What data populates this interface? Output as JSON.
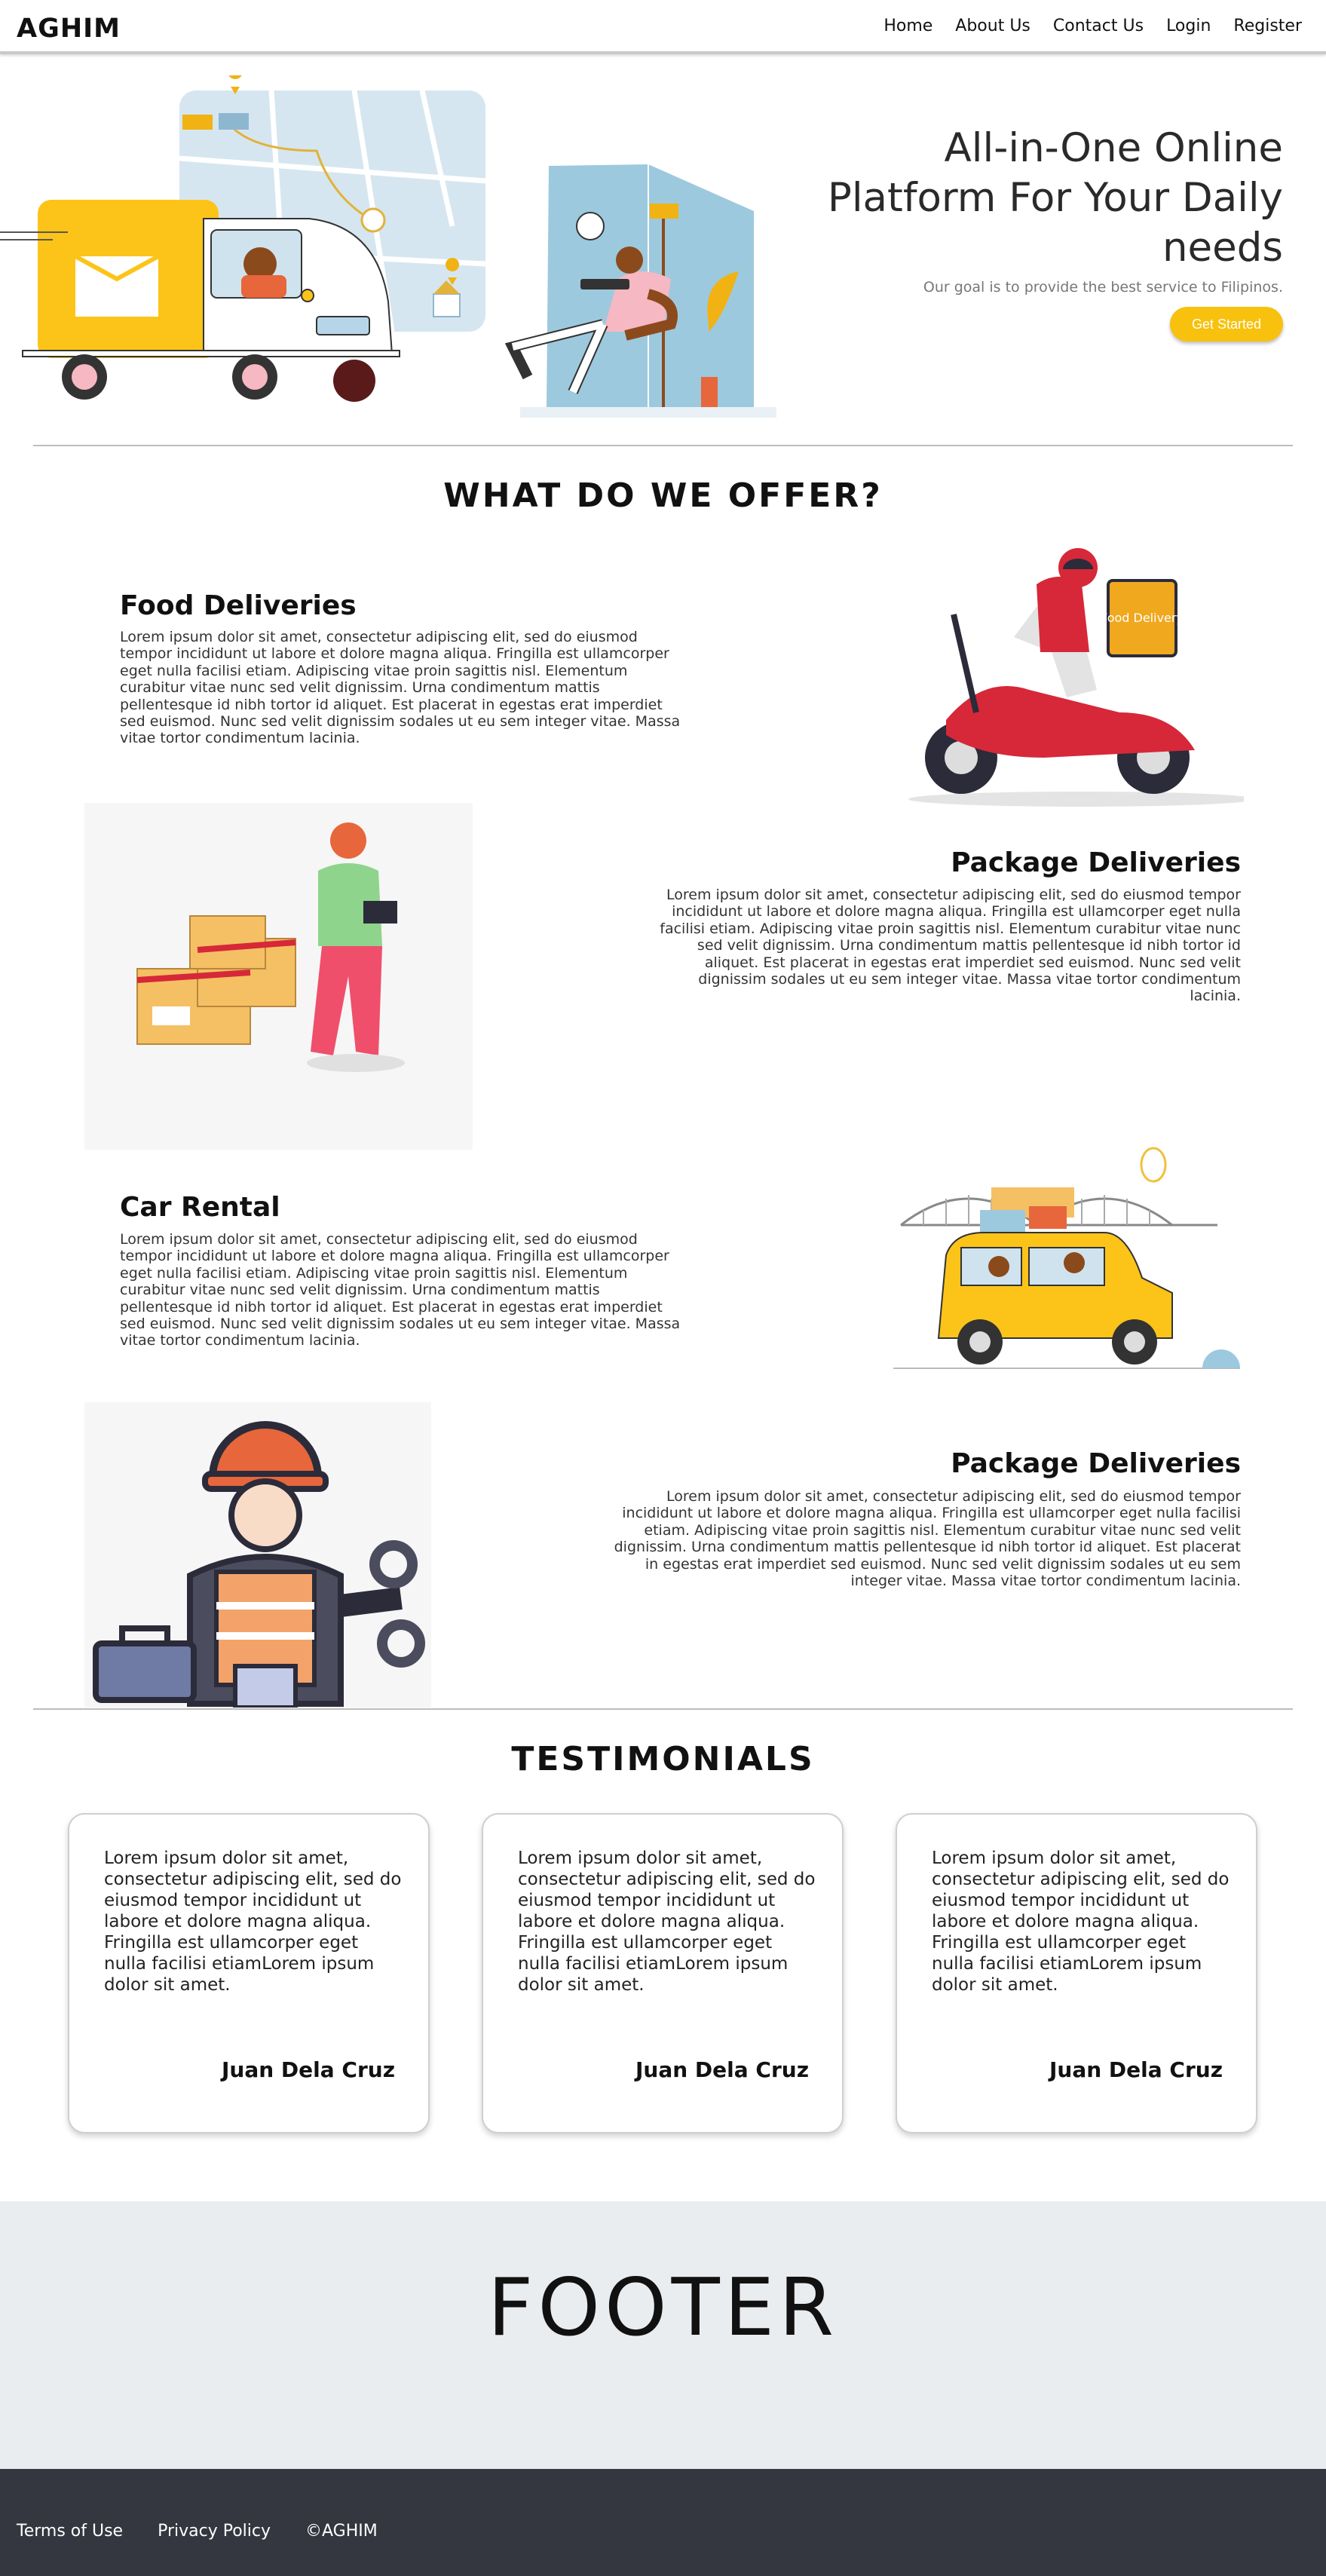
{
  "nav": {
    "brand": "AGHIM",
    "links": [
      "Home",
      "About Us",
      "Contact Us",
      "Login",
      "Register"
    ]
  },
  "hero": {
    "title": "All-in-One Online Platform For Your Daily needs",
    "subtitle": "Our goal is to provide the best service to Filipinos.",
    "cta": "Get Started"
  },
  "offer": {
    "heading": "WHAT DO WE OFFER?",
    "services": [
      {
        "title": "Food Deliveries",
        "text": "Lorem ipsum dolor sit amet, consectetur adipiscing elit, sed do eiusmod tempor incididunt ut labore et dolore magna aliqua. Fringilla est ullamcorper eget nulla facilisi etiam. Adipiscing vitae proin sagittis nisl. Elementum curabitur vitae nunc sed velit dignissim. Urna condimentum mattis pellentesque id nibh tortor id aliquet. Est placerat in egestas erat imperdiet sed euismod. Nunc sed velit dignissim sodales ut eu sem integer vitae. Massa vitae tortor condimentum lacinia.",
        "badge": "Food Delivery"
      },
      {
        "title": "Package Deliveries",
        "text": "Lorem ipsum dolor sit amet, consectetur adipiscing elit, sed do eiusmod tempor incididunt ut labore et dolore magna aliqua. Fringilla est ullamcorper eget nulla facilisi etiam. Adipiscing vitae proin sagittis nisl. Elementum curabitur vitae nunc sed velit dignissim. Urna condimentum mattis pellentesque id nibh tortor id aliquet. Est placerat in egestas erat imperdiet sed euismod. Nunc sed velit dignissim sodales ut eu sem integer vitae. Massa vitae tortor condimentum lacinia."
      },
      {
        "title": "Car Rental",
        "text": "Lorem ipsum dolor sit amet, consectetur adipiscing elit, sed do eiusmod tempor incididunt ut labore et dolore magna aliqua. Fringilla est ullamcorper eget nulla facilisi etiam. Adipiscing vitae proin sagittis nisl. Elementum curabitur vitae nunc sed velit dignissim. Urna condimentum mattis pellentesque id nibh tortor id aliquet. Est placerat in egestas erat imperdiet sed euismod. Nunc sed velit dignissim sodales ut eu sem integer vitae. Massa vitae tortor condimentum lacinia."
      },
      {
        "title": "Package Deliveries",
        "text": "Lorem ipsum dolor sit amet, consectetur adipiscing elit, sed do eiusmod tempor incididunt ut labore et dolore magna aliqua. Fringilla est ullamcorper eget nulla facilisi etiam. Adipiscing vitae proin sagittis nisl. Elementum curabitur vitae nunc sed velit dignissim. Urna condimentum mattis pellentesque id nibh tortor id aliquet. Est placerat in egestas erat imperdiet sed euismod. Nunc sed velit dignissim sodales ut eu sem integer vitae. Massa vitae tortor condimentum lacinia."
      }
    ]
  },
  "testimonials": {
    "heading": "TESTIMONIALS",
    "items": [
      {
        "text": "Lorem ipsum dolor sit amet, consectetur adipiscing elit, sed do eiusmod tempor incididunt ut labore et dolore magna aliqua. Fringilla est ullamcorper eget nulla facilisi etiamLorem ipsum dolor sit amet.",
        "name": "Juan Dela Cruz"
      },
      {
        "text": "Lorem ipsum dolor sit amet, consectetur adipiscing elit, sed do eiusmod tempor incididunt ut labore et dolore magna aliqua. Fringilla est ullamcorper eget nulla facilisi etiamLorem ipsum dolor sit amet.",
        "name": "Juan Dela Cruz"
      },
      {
        "text": "Lorem ipsum dolor sit amet, consectetur adipiscing elit, sed do eiusmod tempor incididunt ut labore et dolore magna aliqua. Fringilla est ullamcorper eget nulla facilisi etiamLorem ipsum dolor sit amet.",
        "name": "Juan Dela Cruz"
      }
    ]
  },
  "footer": {
    "title": "FOOTER",
    "links": [
      "Terms of Use",
      "Privacy Policy",
      "©AGHIM"
    ]
  },
  "colors": {
    "accent": "#f8c10d",
    "footer_light": "#e9edf0",
    "footer_dark": "#343640",
    "hero_blue": "#9dc9de"
  }
}
